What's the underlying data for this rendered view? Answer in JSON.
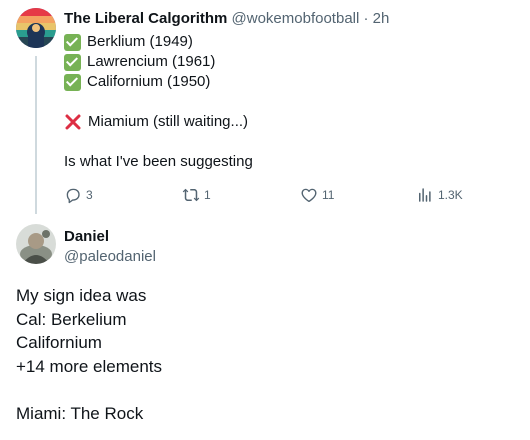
{
  "tweet1": {
    "display_name": "The Liberal Calgorithm",
    "handle": "@wokemobfootball",
    "separator": "·",
    "time": "2h",
    "lines": [
      "Berklium (1949)",
      "Lawrencium (1961)",
      "Californium (1950)"
    ],
    "waiting_line": "Miamium (still waiting...)",
    "closing_line": "Is what I've been suggesting",
    "stats": {
      "replies": "3",
      "retweets": "1",
      "likes": "11",
      "views": "1.3K"
    },
    "icons": {
      "check": "check-mark-emoji",
      "cross": "cross-mark-emoji"
    },
    "colors": {
      "check": "#77b255",
      "cross": "#dd2e44"
    }
  },
  "tweet2": {
    "display_name": "Daniel",
    "handle": "@paleodaniel",
    "body_lines": [
      "My sign idea was",
      "Cal: Berkelium",
      "Californium",
      "+14 more elements",
      "",
      "Miami: The Rock"
    ]
  }
}
